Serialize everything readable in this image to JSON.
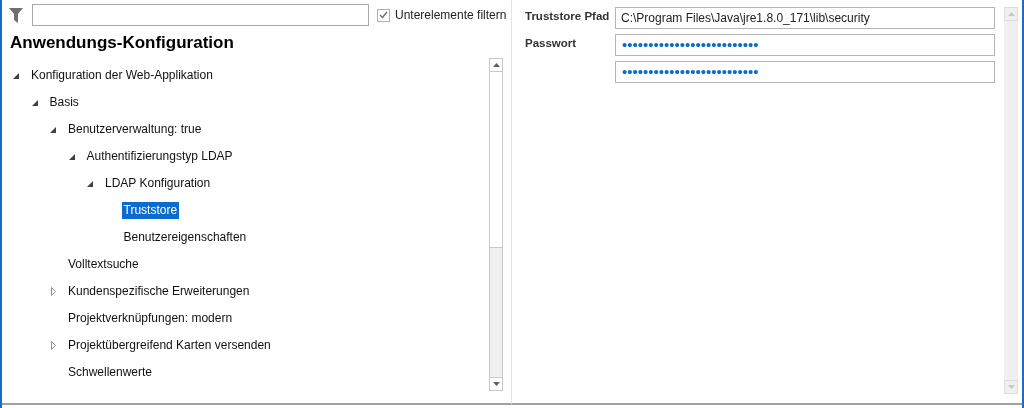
{
  "filter": {
    "subitems_checkbox": {
      "label": "Unterelemente filtern",
      "checked": true
    }
  },
  "title": "Anwendungs-Konfiguration",
  "tree": [
    {
      "label": "Konfiguration der Web-Applikation",
      "expanded": true,
      "selected": false,
      "children": [
        {
          "label": "Basis",
          "expanded": true,
          "selected": false,
          "children": [
            {
              "label": "Benutzerverwaltung: true",
              "expanded": true,
              "selected": false,
              "children": [
                {
                  "label": "Authentifizierungstyp LDAP",
                  "expanded": true,
                  "selected": false,
                  "children": [
                    {
                      "label": "LDAP Konfiguration",
                      "expanded": true,
                      "selected": false,
                      "children": [
                        {
                          "label": "Truststore",
                          "selected": true
                        },
                        {
                          "label": "Benutzereigenschaften",
                          "selected": false
                        }
                      ]
                    }
                  ]
                }
              ]
            },
            {
              "label": "Volltextsuche",
              "selected": false
            },
            {
              "label": "Kundenspezifische Erweiterungen",
              "expanded": false,
              "selected": false
            },
            {
              "label": "Projektverknüpfungen: modern",
              "selected": false
            },
            {
              "label": "Projektübergreifend Karten versenden",
              "expanded": false,
              "selected": false
            },
            {
              "label": "Schwellenwerte",
              "selected": false
            }
          ]
        }
      ]
    }
  ],
  "form": [
    {
      "label": "Truststore Pfad",
      "kind": "text",
      "value": "C:\\Program Files\\Java\\jre1.8.0_171\\lib\\security"
    },
    {
      "label": "Passwort",
      "kind": "password",
      "value": "••••••••••••••••••••••••••"
    },
    {
      "kind": "password",
      "value": "••••••••••••••••••••••••••"
    }
  ]
}
